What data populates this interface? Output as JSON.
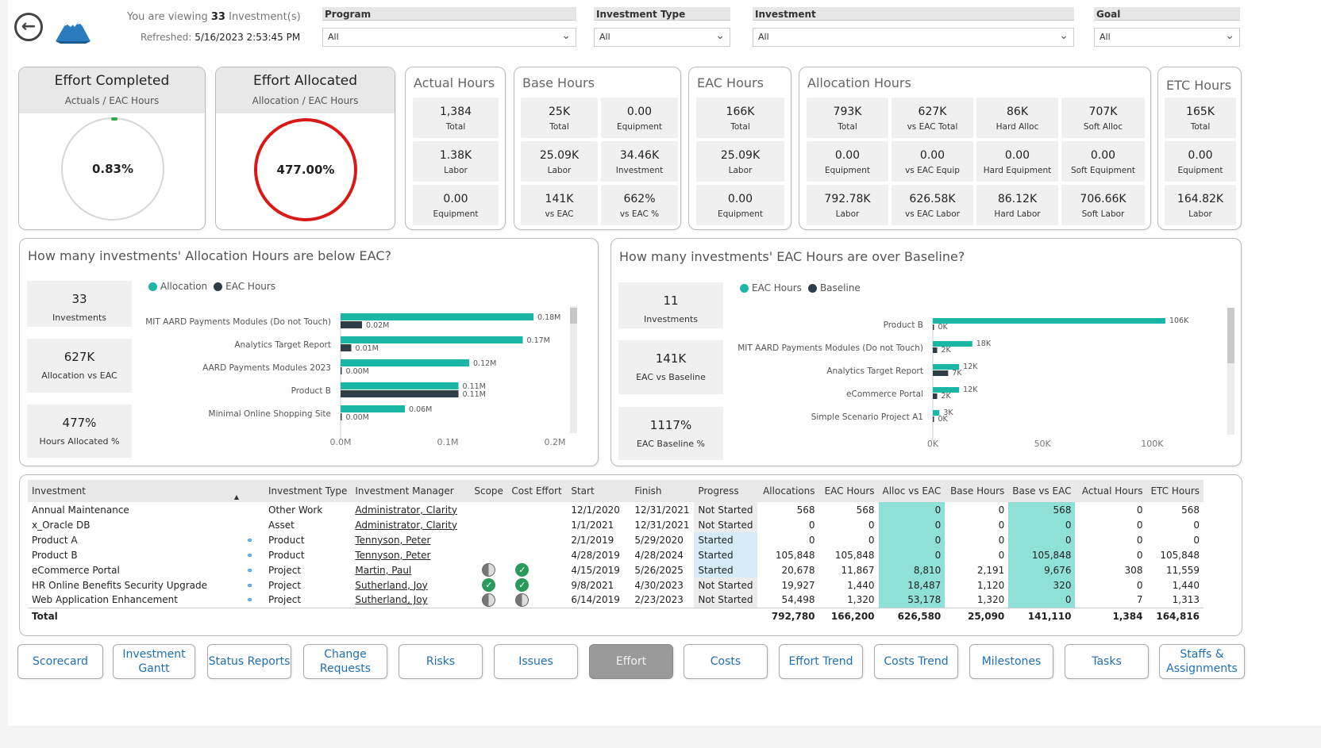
{
  "header": {
    "viewing_prefix": "You are viewing",
    "viewing_count": "33",
    "viewing_suffix": "Investment(s)",
    "refreshed_label": "Refreshed:",
    "refreshed_value": "5/16/2023 2:53:45 PM"
  },
  "filters": [
    {
      "label": "Program",
      "value": "All"
    },
    {
      "label": "Investment Type",
      "value": "All"
    },
    {
      "label": "Investment",
      "value": "All"
    },
    {
      "label": "Goal",
      "value": "All"
    }
  ],
  "gauges": {
    "completed": {
      "title": "Effort Completed",
      "subtitle": "Actuals / EAC Hours",
      "value": "0.83%",
      "fraction": 0.0083,
      "color": "#2ea84a"
    },
    "allocated": {
      "title": "Effort Allocated",
      "subtitle": "Allocation / EAC Hours",
      "value": "477.00%",
      "fraction": 4.77,
      "color": "#d91818"
    }
  },
  "metrics": {
    "actual": {
      "title": "Actual Hours",
      "items": [
        {
          "value": "1,384",
          "label": "Total"
        },
        {
          "value": "1.38K",
          "label": "Labor"
        },
        {
          "value": "0.00",
          "label": "Equipment"
        }
      ]
    },
    "base": {
      "title": "Base Hours",
      "items": [
        {
          "value": "25K",
          "label": "Total"
        },
        {
          "value": "0.00",
          "label": "Equipment"
        },
        {
          "value": "25.09K",
          "label": "Labor"
        },
        {
          "value": "34.46K",
          "label": "Investment"
        },
        {
          "value": "141K",
          "label": "vs EAC"
        },
        {
          "value": "662%",
          "label": "vs EAC %"
        }
      ]
    },
    "eac": {
      "title": "EAC Hours",
      "items": [
        {
          "value": "166K",
          "label": "Total"
        },
        {
          "value": "25.09K",
          "label": "Labor"
        },
        {
          "value": "0.00",
          "label": "Equipment"
        }
      ]
    },
    "allocation": {
      "title": "Allocation Hours",
      "items": [
        {
          "value": "793K",
          "label": "Total"
        },
        {
          "value": "627K",
          "label": "vs EAC Total"
        },
        {
          "value": "86K",
          "label": "Hard Alloc"
        },
        {
          "value": "707K",
          "label": "Soft Alloc"
        },
        {
          "value": "0.00",
          "label": "Equipment"
        },
        {
          "value": "0.00",
          "label": "vs EAC Equip"
        },
        {
          "value": "0.00",
          "label": "Hard Equipment"
        },
        {
          "value": "0.00",
          "label": "Soft Equipment"
        },
        {
          "value": "792.78K",
          "label": "Labor"
        },
        {
          "value": "626.58K",
          "label": "vs EAC Labor"
        },
        {
          "value": "86.12K",
          "label": "Hard Labor"
        },
        {
          "value": "706.66K",
          "label": "Soft Labor"
        }
      ]
    },
    "etc": {
      "title": "ETC Hours",
      "items": [
        {
          "value": "165K",
          "label": "Total"
        },
        {
          "value": "0.00",
          "label": "Equipment"
        },
        {
          "value": "164.82K",
          "label": "Labor"
        }
      ]
    }
  },
  "alloc_panel": {
    "title": "How many investments' Allocation Hours are below EAC?",
    "kpis": [
      {
        "value": "33",
        "label": "Investments"
      },
      {
        "value": "627K",
        "label": "Allocation vs EAC"
      },
      {
        "value": "477%",
        "label": "Hours Allocated %"
      }
    ]
  },
  "eac_panel": {
    "title": "How many investments' EAC Hours are over Baseline?",
    "kpis": [
      {
        "value": "11",
        "label": "Investments"
      },
      {
        "value": "141K",
        "label": "EAC vs Baseline"
      },
      {
        "value": "1117%",
        "label": "EAC Baseline %"
      }
    ]
  },
  "chart_data": [
    {
      "type": "bar",
      "orientation": "horizontal",
      "categories": [
        "MIT AARD Payments Modules (Do not Touch)",
        "Analytics Target Report",
        "AARD Payments Modules 2023",
        "Product B",
        "Minimal Online Shopping Site"
      ],
      "series": [
        {
          "name": "Allocation",
          "color": "#1ab6a6",
          "values": [
            0.18,
            0.17,
            0.12,
            0.11,
            0.06
          ],
          "labels": [
            "0.18M",
            "0.17M",
            "0.12M",
            "0.11M",
            "0.06M"
          ]
        },
        {
          "name": "EAC Hours",
          "color": "#2f3d46",
          "values": [
            0.02,
            0.01,
            0.0,
            0.11,
            0.0
          ],
          "labels": [
            "0.02M",
            "0.01M",
            "0.00M",
            "0.11M",
            "0.00M"
          ]
        }
      ],
      "xlim": [
        0,
        0.2
      ],
      "xticks": [
        "0.0M",
        "0.1M",
        "0.2M"
      ]
    },
    {
      "type": "bar",
      "orientation": "horizontal",
      "categories": [
        "Product B",
        "MIT AARD Payments Modules (Do not Touch)",
        "Analytics Target Report",
        "eCommerce Portal",
        "Simple Scenario Project A1"
      ],
      "series": [
        {
          "name": "EAC Hours",
          "color": "#1ab6a6",
          "values": [
            106,
            18,
            12,
            12,
            3
          ],
          "labels": [
            "106K",
            "18K",
            "12K",
            "12K",
            "3K"
          ]
        },
        {
          "name": "Baseline",
          "color": "#2f3d46",
          "values": [
            0,
            2,
            7,
            2,
            0
          ],
          "labels": [
            "0K",
            "2K",
            "7K",
            "2K",
            "0K"
          ]
        }
      ],
      "xlim": [
        0,
        110
      ],
      "xticks": [
        "0K",
        "50K",
        "100K"
      ]
    }
  ],
  "table": {
    "columns": [
      "Investment",
      "Investment Type",
      "Investment Manager",
      "Scope",
      "Cost Effort",
      "Start",
      "Finish",
      "Progress",
      "Allocations",
      "EAC Hours",
      "Alloc vs EAC",
      "Base Hours",
      "Base vs EAC",
      "Actual Hours",
      "ETC Hours"
    ],
    "rows": [
      {
        "investment": "Annual Maintenance",
        "link": false,
        "type": "Other Work",
        "manager": "Administrator, Clarity",
        "scope": "",
        "cost": "",
        "start": "12/1/2020",
        "finish": "12/31/2021",
        "progress": "Not Started",
        "alloc": "568",
        "eac": "568",
        "alloc_vs_eac": "0",
        "base": "0",
        "base_vs_eac": "568",
        "actual": "0",
        "etc": "568"
      },
      {
        "investment": "x_Oracle DB",
        "link": false,
        "type": "Asset",
        "manager": "Administrator, Clarity",
        "scope": "",
        "cost": "",
        "start": "1/1/2021",
        "finish": "12/31/2021",
        "progress": "Not Started",
        "alloc": "0",
        "eac": "0",
        "alloc_vs_eac": "0",
        "base": "0",
        "base_vs_eac": "0",
        "actual": "0",
        "etc": "0"
      },
      {
        "investment": "Product A",
        "link": true,
        "type": "Product",
        "manager": "Tennyson, Peter",
        "scope": "",
        "cost": "",
        "start": "2/1/2019",
        "finish": "5/29/2020",
        "progress": "Started",
        "alloc": "0",
        "eac": "0",
        "alloc_vs_eac": "0",
        "base": "0",
        "base_vs_eac": "0",
        "actual": "0",
        "etc": "0"
      },
      {
        "investment": "Product B",
        "link": true,
        "type": "Product",
        "manager": "Tennyson, Peter",
        "scope": "",
        "cost": "",
        "start": "4/28/2019",
        "finish": "4/28/2024",
        "progress": "Started",
        "alloc": "105,848",
        "eac": "105,848",
        "alloc_vs_eac": "0",
        "base": "0",
        "base_vs_eac": "105,848",
        "actual": "0",
        "etc": "105,848"
      },
      {
        "investment": "eCommerce Portal",
        "link": true,
        "type": "Project",
        "manager": "Martin, Paul",
        "scope": "half",
        "cost": "ok",
        "start": "4/15/2019",
        "finish": "5/26/2025",
        "progress": "Started",
        "alloc": "20,678",
        "eac": "11,867",
        "alloc_vs_eac": "8,810",
        "base": "2,191",
        "base_vs_eac": "9,676",
        "actual": "308",
        "etc": "11,559"
      },
      {
        "investment": "HR Online Benefits Security Upgrade",
        "link": true,
        "type": "Project",
        "manager": "Sutherland, Joy",
        "scope": "ok",
        "cost": "ok",
        "start": "9/8/2021",
        "finish": "4/30/2023",
        "progress": "Not Started",
        "alloc": "19,927",
        "eac": "1,440",
        "alloc_vs_eac": "18,487",
        "base": "1,120",
        "base_vs_eac": "320",
        "actual": "0",
        "etc": "1,440"
      },
      {
        "investment": "Web Application Enhancement",
        "link": true,
        "type": "Project",
        "manager": "Sutherland, Joy",
        "scope": "half",
        "cost": "half",
        "start": "6/14/2019",
        "finish": "2/23/2023",
        "progress": "Not Started",
        "alloc": "54,498",
        "eac": "1,320",
        "alloc_vs_eac": "53,178",
        "base": "1,320",
        "base_vs_eac": "0",
        "actual": "7",
        "etc": "1,313"
      }
    ],
    "total": {
      "label": "Total",
      "alloc": "792,780",
      "eac": "166,200",
      "alloc_vs_eac": "626,580",
      "base": "25,090",
      "base_vs_eac": "141,110",
      "actual": "1,384",
      "etc": "164,816"
    }
  },
  "nav": [
    "Scorecard",
    "Investment Gantt",
    "Status Reports",
    "Change Requests",
    "Risks",
    "Issues",
    "Effort",
    "Costs",
    "Effort Trend",
    "Costs Trend",
    "Milestones",
    "Tasks",
    "Staffs & Assignments"
  ],
  "nav_active": "Effort",
  "colors": {
    "teal": "#1ab6a6",
    "dark": "#2f3d46",
    "link": "#1f6fb2"
  }
}
